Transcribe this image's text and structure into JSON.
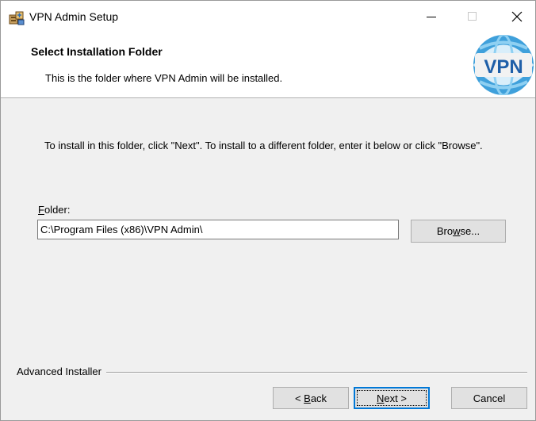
{
  "window": {
    "title": "VPN Admin Setup",
    "icons": {
      "app": "installer-icon",
      "minimize": "minimize-icon",
      "maximize": "maximize-icon",
      "close": "close-icon"
    }
  },
  "header": {
    "title": "Select Installation Folder",
    "description": "This is the folder where VPN Admin will be installed.",
    "logo_text": "VPN",
    "logo_colors": {
      "globe": "#4aa8e0",
      "globe_light": "#8fd0f2",
      "text": "#1f5fa8"
    }
  },
  "body": {
    "instruction": "To install in this folder, click \"Next\". To install to a different folder, enter it below or click \"Browse\".",
    "folder_label_accel": "F",
    "folder_label_rest": "older:",
    "folder_value": "C:\\Program Files (x86)\\VPN Admin\\",
    "browse_pre": "Bro",
    "browse_accel": "w",
    "browse_post": "se..."
  },
  "footer": {
    "brand": "Advanced Installer",
    "back_pre": "< ",
    "back_accel": "B",
    "back_post": "ack",
    "next_accel": "N",
    "next_post": "ext >",
    "cancel": "Cancel"
  },
  "colors": {
    "focus_accent": "#0078d7",
    "dialog_bg": "#f0f0f0",
    "button_bg": "#e1e1e1"
  }
}
